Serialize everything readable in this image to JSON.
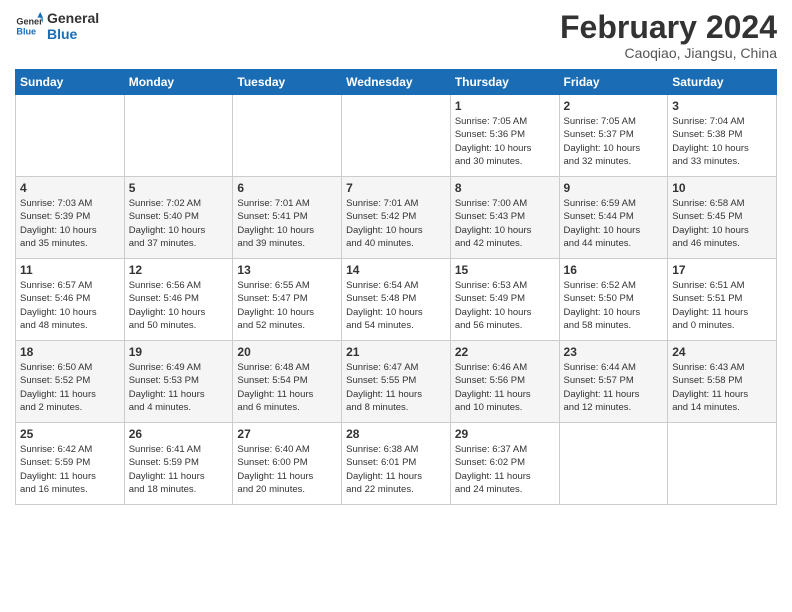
{
  "logo": {
    "line1": "General",
    "line2": "Blue"
  },
  "title": "February 2024",
  "subtitle": "Caoqiao, Jiangsu, China",
  "days_of_week": [
    "Sunday",
    "Monday",
    "Tuesday",
    "Wednesday",
    "Thursday",
    "Friday",
    "Saturday"
  ],
  "weeks": [
    [
      {
        "day": "",
        "info": ""
      },
      {
        "day": "",
        "info": ""
      },
      {
        "day": "",
        "info": ""
      },
      {
        "day": "",
        "info": ""
      },
      {
        "day": "1",
        "info": "Sunrise: 7:05 AM\nSunset: 5:36 PM\nDaylight: 10 hours\nand 30 minutes."
      },
      {
        "day": "2",
        "info": "Sunrise: 7:05 AM\nSunset: 5:37 PM\nDaylight: 10 hours\nand 32 minutes."
      },
      {
        "day": "3",
        "info": "Sunrise: 7:04 AM\nSunset: 5:38 PM\nDaylight: 10 hours\nand 33 minutes."
      }
    ],
    [
      {
        "day": "4",
        "info": "Sunrise: 7:03 AM\nSunset: 5:39 PM\nDaylight: 10 hours\nand 35 minutes."
      },
      {
        "day": "5",
        "info": "Sunrise: 7:02 AM\nSunset: 5:40 PM\nDaylight: 10 hours\nand 37 minutes."
      },
      {
        "day": "6",
        "info": "Sunrise: 7:01 AM\nSunset: 5:41 PM\nDaylight: 10 hours\nand 39 minutes."
      },
      {
        "day": "7",
        "info": "Sunrise: 7:01 AM\nSunset: 5:42 PM\nDaylight: 10 hours\nand 40 minutes."
      },
      {
        "day": "8",
        "info": "Sunrise: 7:00 AM\nSunset: 5:43 PM\nDaylight: 10 hours\nand 42 minutes."
      },
      {
        "day": "9",
        "info": "Sunrise: 6:59 AM\nSunset: 5:44 PM\nDaylight: 10 hours\nand 44 minutes."
      },
      {
        "day": "10",
        "info": "Sunrise: 6:58 AM\nSunset: 5:45 PM\nDaylight: 10 hours\nand 46 minutes."
      }
    ],
    [
      {
        "day": "11",
        "info": "Sunrise: 6:57 AM\nSunset: 5:46 PM\nDaylight: 10 hours\nand 48 minutes."
      },
      {
        "day": "12",
        "info": "Sunrise: 6:56 AM\nSunset: 5:46 PM\nDaylight: 10 hours\nand 50 minutes."
      },
      {
        "day": "13",
        "info": "Sunrise: 6:55 AM\nSunset: 5:47 PM\nDaylight: 10 hours\nand 52 minutes."
      },
      {
        "day": "14",
        "info": "Sunrise: 6:54 AM\nSunset: 5:48 PM\nDaylight: 10 hours\nand 54 minutes."
      },
      {
        "day": "15",
        "info": "Sunrise: 6:53 AM\nSunset: 5:49 PM\nDaylight: 10 hours\nand 56 minutes."
      },
      {
        "day": "16",
        "info": "Sunrise: 6:52 AM\nSunset: 5:50 PM\nDaylight: 10 hours\nand 58 minutes."
      },
      {
        "day": "17",
        "info": "Sunrise: 6:51 AM\nSunset: 5:51 PM\nDaylight: 11 hours\nand 0 minutes."
      }
    ],
    [
      {
        "day": "18",
        "info": "Sunrise: 6:50 AM\nSunset: 5:52 PM\nDaylight: 11 hours\nand 2 minutes."
      },
      {
        "day": "19",
        "info": "Sunrise: 6:49 AM\nSunset: 5:53 PM\nDaylight: 11 hours\nand 4 minutes."
      },
      {
        "day": "20",
        "info": "Sunrise: 6:48 AM\nSunset: 5:54 PM\nDaylight: 11 hours\nand 6 minutes."
      },
      {
        "day": "21",
        "info": "Sunrise: 6:47 AM\nSunset: 5:55 PM\nDaylight: 11 hours\nand 8 minutes."
      },
      {
        "day": "22",
        "info": "Sunrise: 6:46 AM\nSunset: 5:56 PM\nDaylight: 11 hours\nand 10 minutes."
      },
      {
        "day": "23",
        "info": "Sunrise: 6:44 AM\nSunset: 5:57 PM\nDaylight: 11 hours\nand 12 minutes."
      },
      {
        "day": "24",
        "info": "Sunrise: 6:43 AM\nSunset: 5:58 PM\nDaylight: 11 hours\nand 14 minutes."
      }
    ],
    [
      {
        "day": "25",
        "info": "Sunrise: 6:42 AM\nSunset: 5:59 PM\nDaylight: 11 hours\nand 16 minutes."
      },
      {
        "day": "26",
        "info": "Sunrise: 6:41 AM\nSunset: 5:59 PM\nDaylight: 11 hours\nand 18 minutes."
      },
      {
        "day": "27",
        "info": "Sunrise: 6:40 AM\nSunset: 6:00 PM\nDaylight: 11 hours\nand 20 minutes."
      },
      {
        "day": "28",
        "info": "Sunrise: 6:38 AM\nSunset: 6:01 PM\nDaylight: 11 hours\nand 22 minutes."
      },
      {
        "day": "29",
        "info": "Sunrise: 6:37 AM\nSunset: 6:02 PM\nDaylight: 11 hours\nand 24 minutes."
      },
      {
        "day": "",
        "info": ""
      },
      {
        "day": "",
        "info": ""
      }
    ]
  ]
}
